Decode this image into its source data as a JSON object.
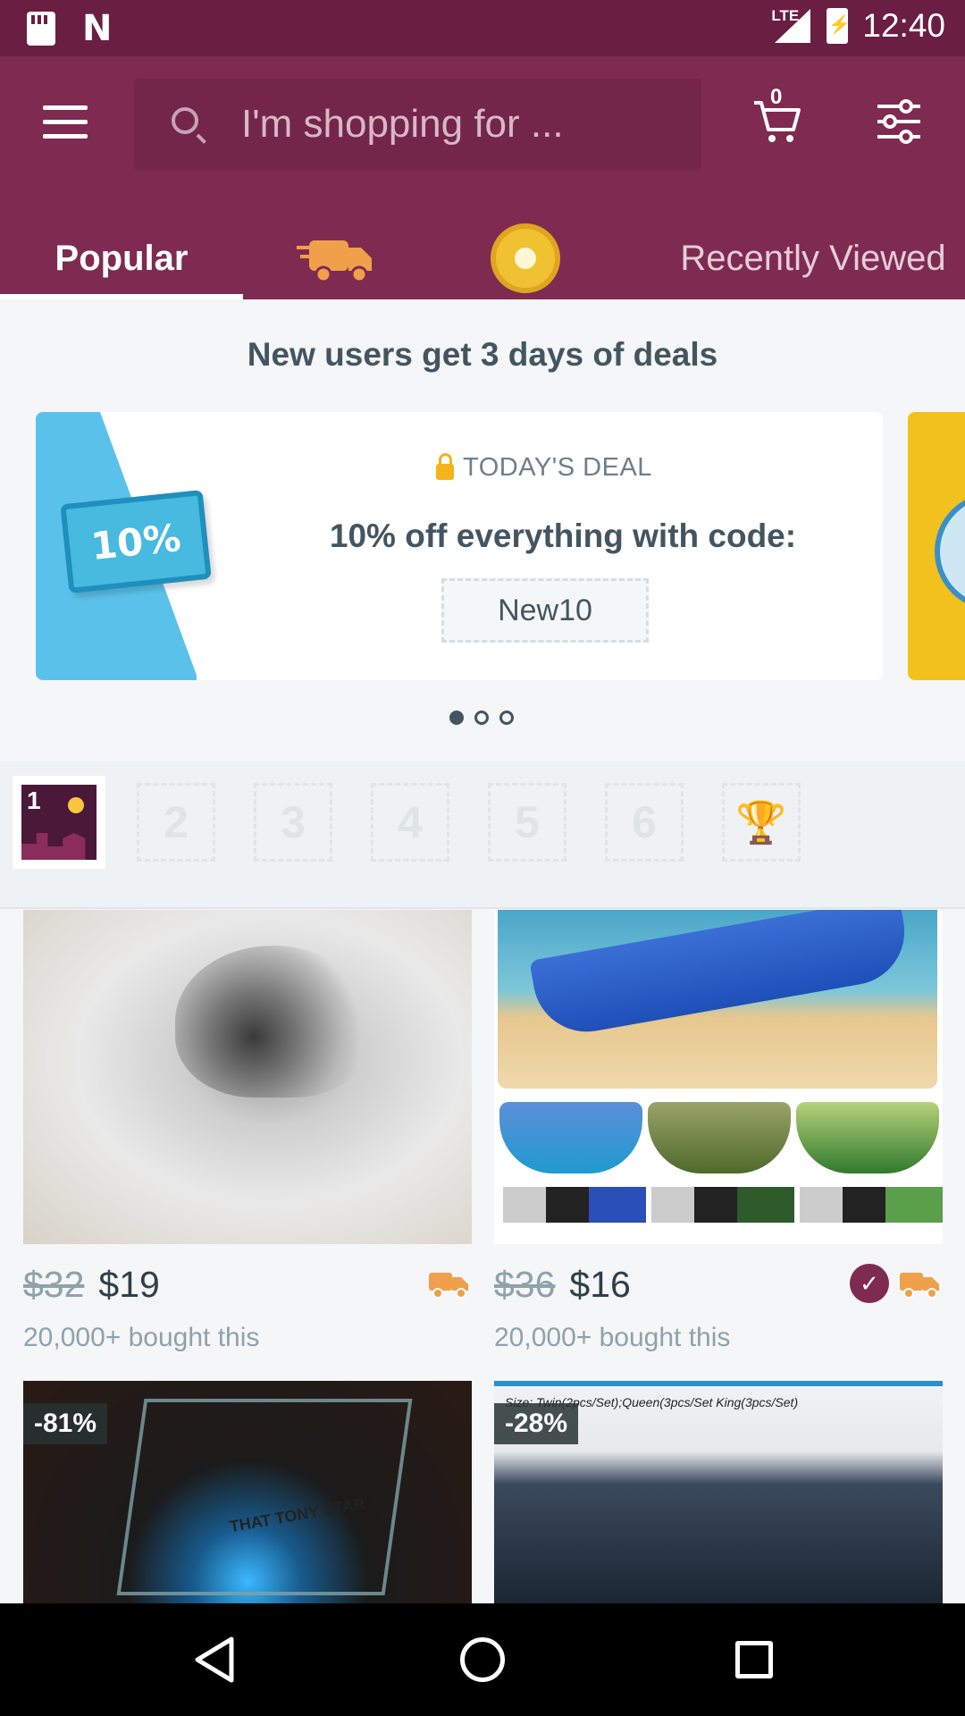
{
  "status_bar": {
    "time": "12:40",
    "network": "LTE",
    "icons": [
      "sd-card-icon",
      "n-notification-icon",
      "lte-signal-icon",
      "battery-charging-icon"
    ]
  },
  "header": {
    "search_placeholder": "I'm shopping for ...",
    "cart_count": "0",
    "icons": [
      "menu-icon",
      "search-icon",
      "cart-icon",
      "filter-icon"
    ]
  },
  "tabs": [
    {
      "label": "Popular",
      "selected": true
    },
    {
      "label": "",
      "icon": "fast-shipping-truck-icon"
    },
    {
      "label": "",
      "icon": "coin-icon"
    },
    {
      "label": "Recently Viewed"
    }
  ],
  "deals": {
    "title": "New users get 3 days of deals",
    "ticket_text": "10%",
    "tag": "TODAY'S DEAL",
    "headline": "10% off everything with code:",
    "code": "New10",
    "pages": 3,
    "active_page": 1
  },
  "streak": {
    "current_day": "1",
    "days": [
      "2",
      "3",
      "4",
      "5",
      "6"
    ],
    "final_icon": "trophy-icon"
  },
  "products": [
    {
      "name": "wolf-bedding",
      "old_price": "$32",
      "price": "$19",
      "bought": "20,000+ bought this",
      "fast_shipping": true,
      "verified": false
    },
    {
      "name": "hammock",
      "old_price": "$36",
      "price": "$16",
      "bought": "20,000+ bought this",
      "fast_shipping": true,
      "verified": true
    },
    {
      "name": "arc-reactor-display",
      "discount": "-81%",
      "caption": "THAT TONY STAR"
    },
    {
      "name": "cat-bedding",
      "discount": "-28%",
      "caption": "Size: Twin(2pcs/Set);Queen(3pcs/Set King(3pcs/Set)"
    }
  ],
  "colors": {
    "brand": "#7f2a50",
    "status_bar": "#6a1e41",
    "accent_orange": "#f0a04b",
    "text_dark": "#2f3f48",
    "text_muted": "#8fa1ab"
  }
}
